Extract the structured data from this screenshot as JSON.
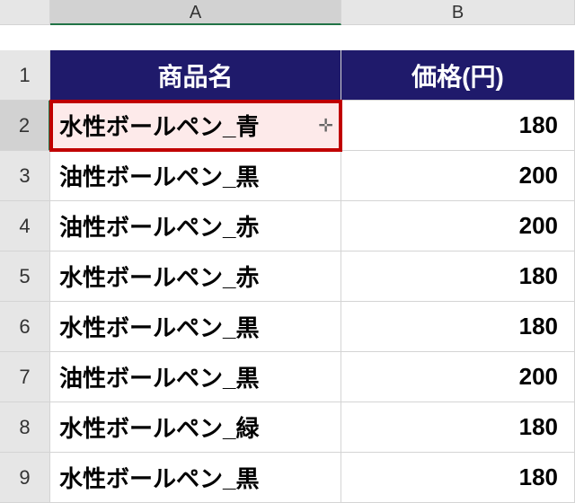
{
  "columns": [
    "A",
    "B"
  ],
  "headers": {
    "a": "商品名",
    "b": "価格(円)"
  },
  "rows": [
    {
      "n": "1"
    },
    {
      "n": "2",
      "a": "水性ボールペン_青",
      "b": "180",
      "selected": true
    },
    {
      "n": "3",
      "a": "油性ボールペン_黒",
      "b": "200"
    },
    {
      "n": "4",
      "a": "油性ボールペン_赤",
      "b": "200"
    },
    {
      "n": "5",
      "a": "水性ボールペン_赤",
      "b": "180"
    },
    {
      "n": "6",
      "a": "水性ボールペン_黒",
      "b": "180"
    },
    {
      "n": "7",
      "a": "油性ボールペン_黒",
      "b": "200"
    },
    {
      "n": "8",
      "a": "水性ボールペン_緑",
      "b": "180"
    },
    {
      "n": "9",
      "a": "水性ボールペン_黒",
      "b": "180"
    }
  ],
  "cursor_glyph": "✛"
}
